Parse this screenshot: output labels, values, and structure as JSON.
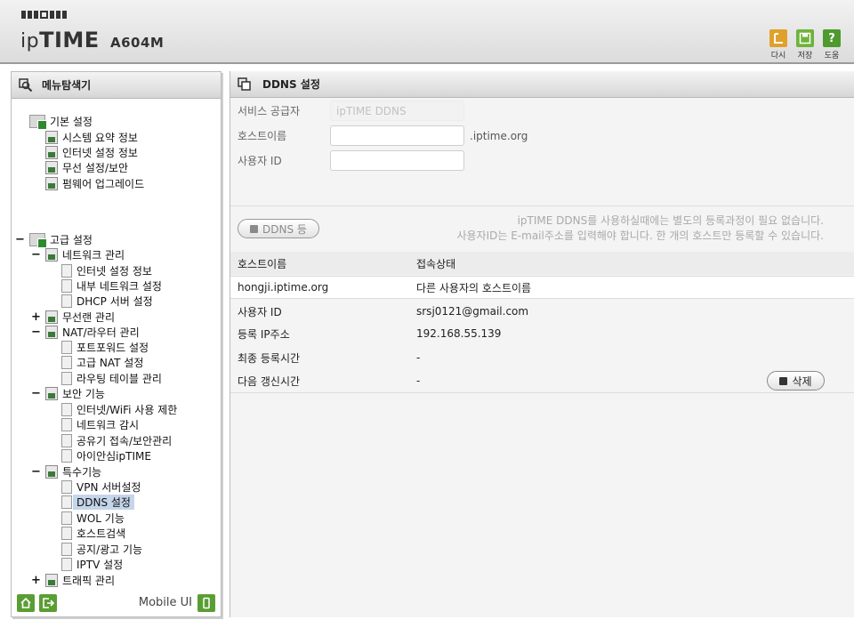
{
  "header": {
    "brand_prefix": "ip",
    "brand_bold": "TIME",
    "model": "A604M",
    "toolbar": [
      {
        "label": "다시",
        "icon": "undo-icon",
        "color": "#e0a12a"
      },
      {
        "label": "저장",
        "icon": "save-icon",
        "color": "#6fb33a"
      },
      {
        "label": "도움",
        "icon": "help-icon",
        "color": "#4e9a2e"
      }
    ]
  },
  "sidebar": {
    "title": "메뉴탐색기",
    "basic": {
      "label": "기본 설정",
      "items": [
        "시스템 요약 정보",
        "인터넷 설정 정보",
        "무선 설정/보안",
        "펌웨어 업그레이드"
      ]
    },
    "advanced": {
      "label": "고급 설정",
      "network": {
        "label": "네트워크 관리",
        "items": [
          "인터넷 설정 정보",
          "내부 네트워크 설정",
          "DHCP 서버 설정"
        ]
      },
      "wireless": {
        "label": "무선랜 관리"
      },
      "nat": {
        "label": "NAT/라우터 관리",
        "items": [
          "포트포워드 설정",
          "고급 NAT 설정",
          "라우팅 테이블 관리"
        ]
      },
      "security": {
        "label": "보안 기능",
        "items": [
          "인터넷/WiFi 사용 제한",
          "네트워크 감시",
          "공유기 접속/보안관리",
          "아이안심ipTIME"
        ]
      },
      "special": {
        "label": "특수기능",
        "items": [
          "VPN 서버설정",
          "DDNS 설정",
          "WOL 기능",
          "호스트검색",
          "공지/광고 기능",
          "IPTV 설정"
        ]
      },
      "traffic": {
        "label": "트래픽 관리"
      }
    },
    "footer": {
      "mobile_label": "Mobile UI"
    }
  },
  "main": {
    "title": "DDNS 설정",
    "form": {
      "provider_label": "서비스 공급자",
      "provider_value": "ipTIME DDNS",
      "hostname_label": "호스트이름",
      "hostname_value": "",
      "hostname_suffix": ".iptime.org",
      "userid_label": "사용자 ID",
      "userid_value": ""
    },
    "add_button": "DDNS 등",
    "note_line1": "ipTIME DDNS를 사용하실때에는 별도의 등록과정이 필요 없습니다.",
    "note_line2": "사용자ID는 E-mail주소를 입력해야 합니다. 한 개의 호스트만 등록할 수 있습니다.",
    "table": {
      "col_host": "호스트이름",
      "col_status": "접속상태",
      "host": "hongji.iptime.org",
      "status": "다른 사용자의 호스트이름",
      "details": [
        {
          "label": "사용자 ID",
          "value": "srsj0121@gmail.com"
        },
        {
          "label": "등록 IP주소",
          "value": "192.168.55.139"
        },
        {
          "label": "최종 등록시간",
          "value": "-"
        },
        {
          "label": "다음 갱신시간",
          "value": "-"
        }
      ],
      "delete_button": "삭제"
    }
  }
}
